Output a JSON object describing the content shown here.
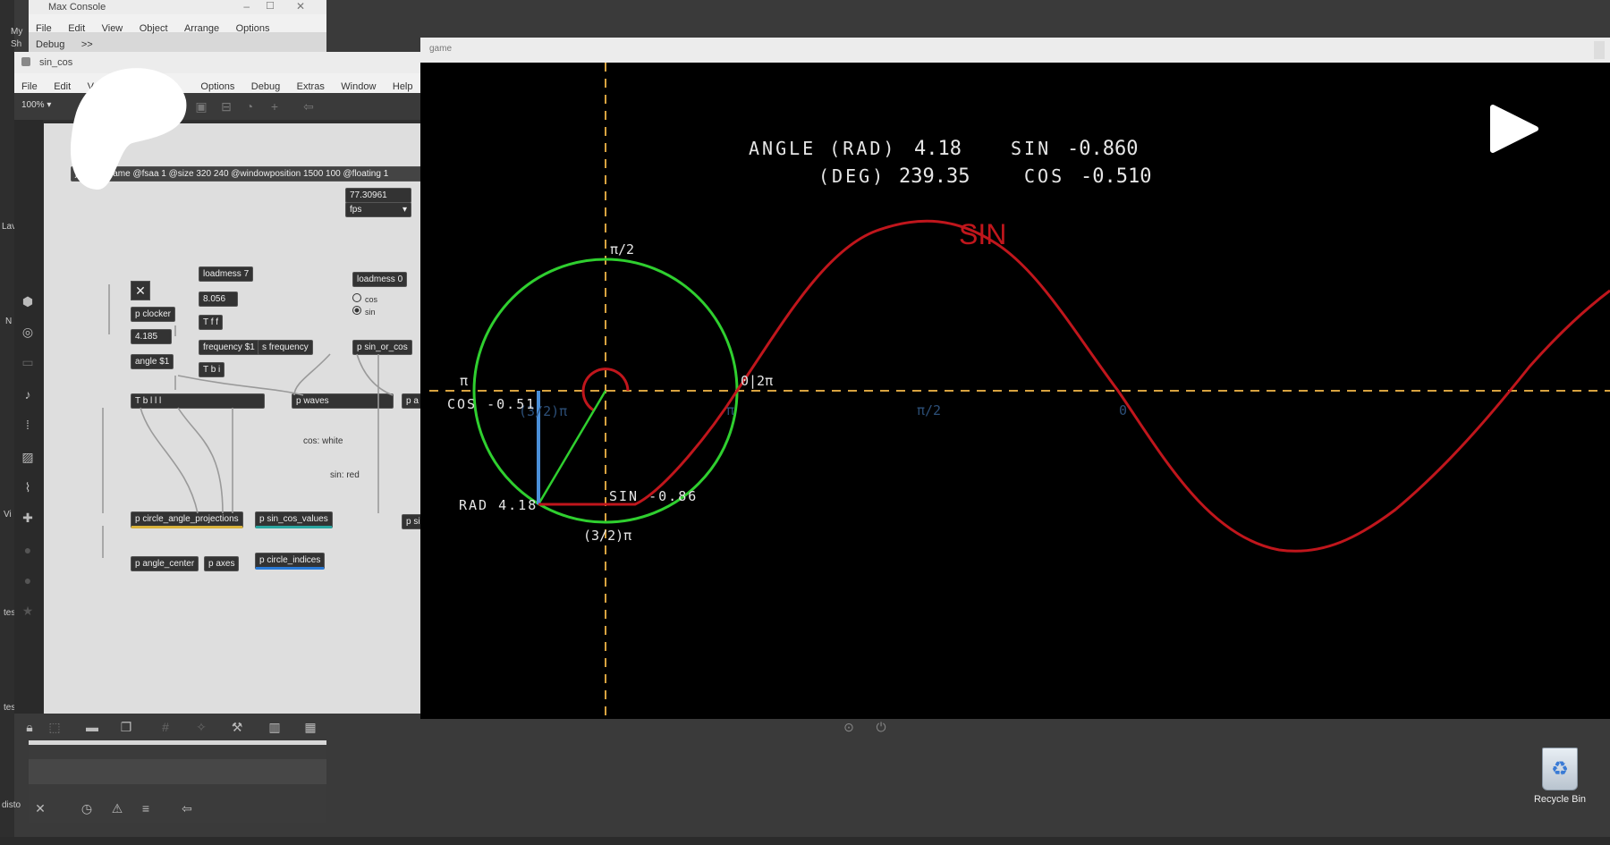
{
  "desktop": {
    "recycle_bin_label": "Recycle Bin",
    "left_labels": [
      "My",
      "Sh",
      "Lav",
      "N",
      "Vi",
      "tes",
      "tes",
      "disto"
    ]
  },
  "max_console": {
    "title": "Max Console",
    "menu": [
      "File",
      "Edit",
      "View",
      "Object",
      "Arrange",
      "Options",
      "Debug",
      ">>"
    ]
  },
  "patcher": {
    "title": "sin_cos",
    "menu": [
      "File",
      "Edit",
      "V",
      "Options",
      "Debug",
      "Extras",
      "Window",
      "Help"
    ],
    "zoom": "100%",
    "message_box": "jit.world game @fsaa 1 @size 320 240 @windowposition 1500 100 @floating 1",
    "fps_value": "77.30961",
    "fps_label": "fps",
    "objects": {
      "loadmess7": "loadmess 7",
      "num_8056": "8.056",
      "t_f_f": "T f f",
      "frequency_msg": "frequency $1",
      "s_frequency": "s frequency",
      "t_b_i": "T b i",
      "loadmess0": "loadmess 0",
      "radio_cos": "cos",
      "radio_sin": "sin",
      "p_sin_or_cos": "p sin_or_cos",
      "p_clocker": "p clocker",
      "num_4185": "4.185",
      "angle_msg": "angle $1",
      "t_b_iii": "T b l l l",
      "p_waves": "p waves",
      "p_a": "p a",
      "cos_comment": "cos: white",
      "sin_comment": "sin: red",
      "p_circle_angle_projections": "p circle_angle_projections",
      "p_sin_cos_values": "p sin_cos_values",
      "p_si": "p si",
      "p_angle_center": "p angle_center",
      "p_axes": "p axes",
      "p_circle_indices": "p circle_indices"
    }
  },
  "game_window": {
    "title": "game",
    "readout": {
      "angle_rad_label": "ANGLE (RAD)",
      "angle_rad_value": "4.18",
      "sin_label": "SIN",
      "sin_value": "-0.860",
      "deg_label": "(DEG)",
      "deg_value": "239.35",
      "cos_label": "COS",
      "cos_value": "-0.510"
    },
    "wave_label": "SIN",
    "circle_labels": {
      "top": "π/2",
      "left": "π",
      "right": "0|2π",
      "bottom": "(3/2)π",
      "cos_readout": "COS -0.51",
      "sin_readout": "SIN -0.86",
      "rad_readout": "RAD 4.18",
      "faint_3_2_pi": "(3/2)π"
    },
    "wave_axis_labels": [
      "π",
      "π/2",
      "0"
    ],
    "colors": {
      "circle": "#2fcf2f",
      "wave": "#c0161c",
      "axis": "#d8a340",
      "cos_line": "#4a8fd8",
      "background": "#000000"
    }
  }
}
